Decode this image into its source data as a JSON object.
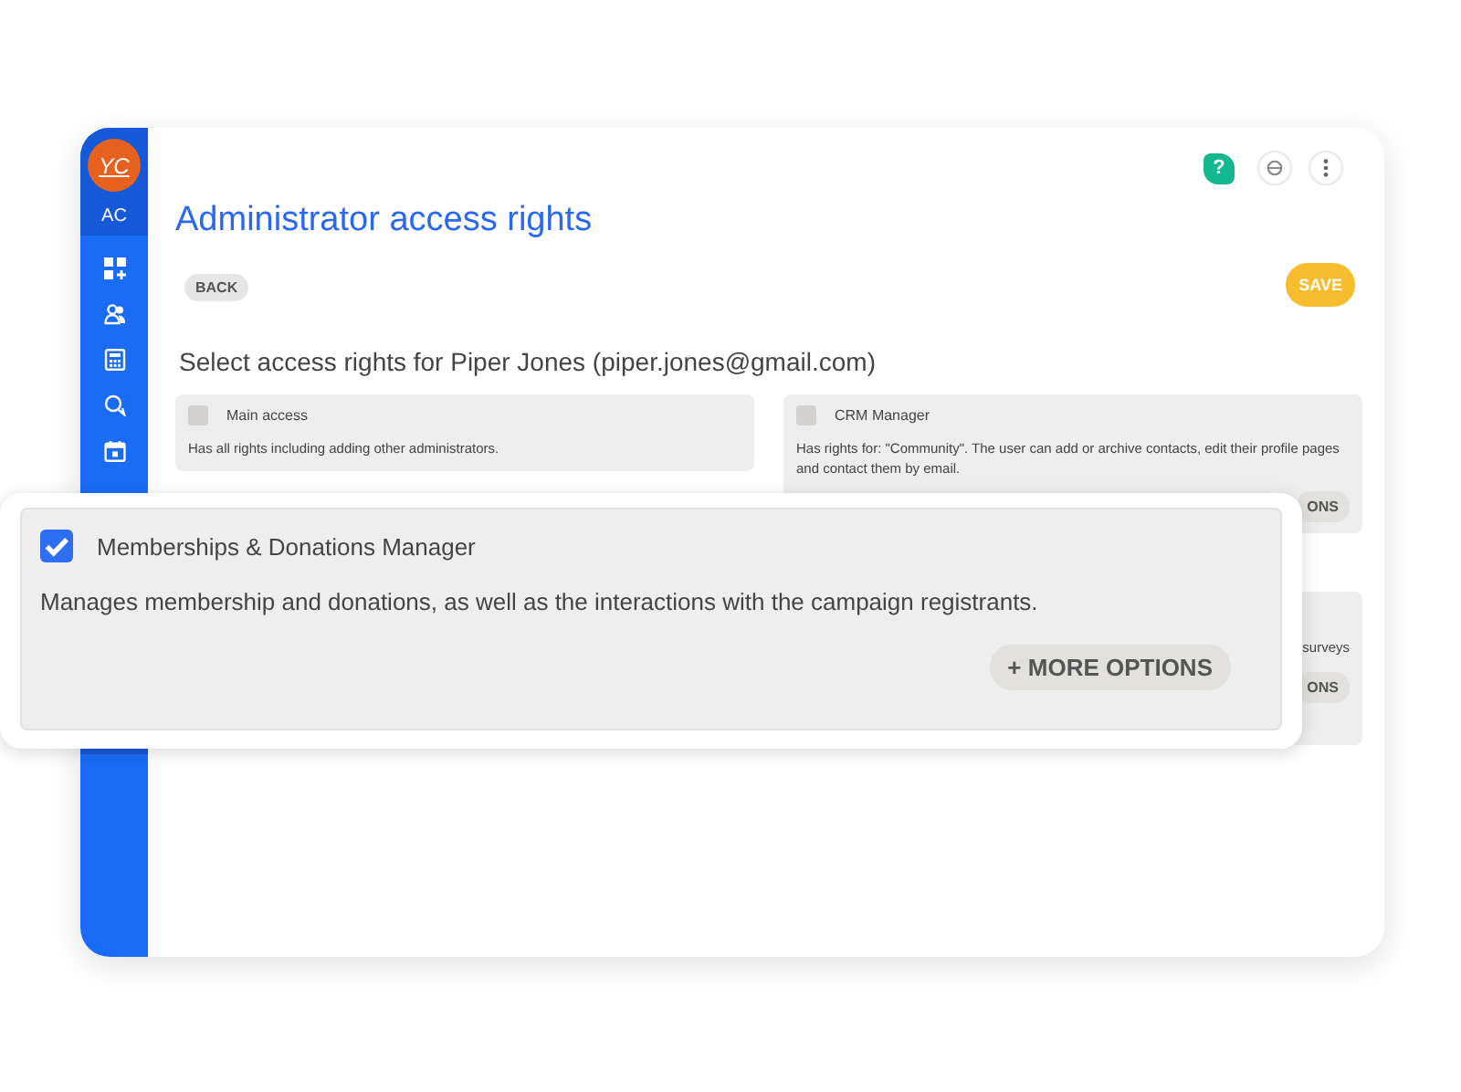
{
  "sidebar": {
    "logo": "YC",
    "account": "AC"
  },
  "help_label": "?",
  "title": "Administrator access rights",
  "back_button": "BACK",
  "save_button": "SAVE",
  "subtitle": "Select access rights for Piper Jones (piper.jones@gmail.com)",
  "left_cards": [
    {
      "title": "Main access",
      "checked": false,
      "description": "Has all rights including adding other administrators."
    }
  ],
  "right_cards": [
    {
      "title": "CRM Manager",
      "checked": false,
      "description": "Has rights for: \"Community\". The user can add or archive contacts, edit their profile pages and contact them by email.",
      "button": "ONS"
    },
    {
      "description": "surveys",
      "button": "ONS"
    }
  ],
  "popup": {
    "title": "Memberships & Donations Manager",
    "checked": true,
    "description": "Manages membership and donations, as well as the interactions with the campaign registrants.",
    "button": "+ MORE OPTIONS"
  }
}
